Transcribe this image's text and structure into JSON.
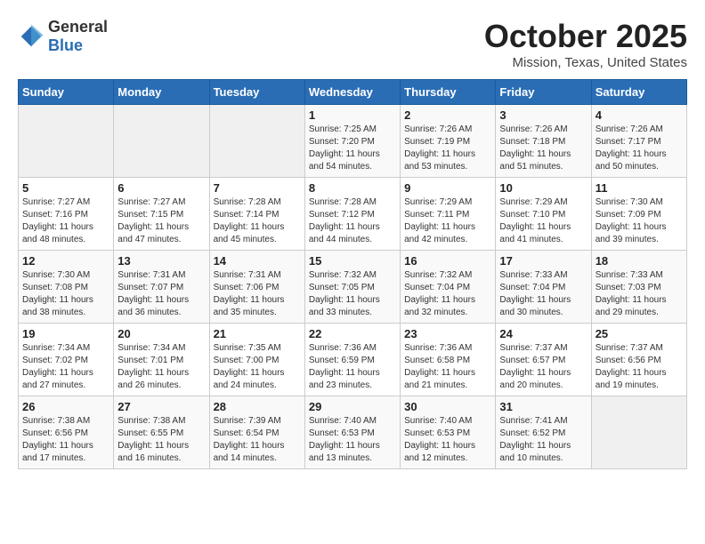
{
  "header": {
    "logo_general": "General",
    "logo_blue": "Blue",
    "month_title": "October 2025",
    "location": "Mission, Texas, United States"
  },
  "days_of_week": [
    "Sunday",
    "Monday",
    "Tuesday",
    "Wednesday",
    "Thursday",
    "Friday",
    "Saturday"
  ],
  "weeks": [
    [
      {
        "day": "",
        "sunrise": "",
        "sunset": "",
        "daylight": ""
      },
      {
        "day": "",
        "sunrise": "",
        "sunset": "",
        "daylight": ""
      },
      {
        "day": "",
        "sunrise": "",
        "sunset": "",
        "daylight": ""
      },
      {
        "day": "1",
        "sunrise": "Sunrise: 7:25 AM",
        "sunset": "Sunset: 7:20 PM",
        "daylight": "Daylight: 11 hours and 54 minutes."
      },
      {
        "day": "2",
        "sunrise": "Sunrise: 7:26 AM",
        "sunset": "Sunset: 7:19 PM",
        "daylight": "Daylight: 11 hours and 53 minutes."
      },
      {
        "day": "3",
        "sunrise": "Sunrise: 7:26 AM",
        "sunset": "Sunset: 7:18 PM",
        "daylight": "Daylight: 11 hours and 51 minutes."
      },
      {
        "day": "4",
        "sunrise": "Sunrise: 7:26 AM",
        "sunset": "Sunset: 7:17 PM",
        "daylight": "Daylight: 11 hours and 50 minutes."
      }
    ],
    [
      {
        "day": "5",
        "sunrise": "Sunrise: 7:27 AM",
        "sunset": "Sunset: 7:16 PM",
        "daylight": "Daylight: 11 hours and 48 minutes."
      },
      {
        "day": "6",
        "sunrise": "Sunrise: 7:27 AM",
        "sunset": "Sunset: 7:15 PM",
        "daylight": "Daylight: 11 hours and 47 minutes."
      },
      {
        "day": "7",
        "sunrise": "Sunrise: 7:28 AM",
        "sunset": "Sunset: 7:14 PM",
        "daylight": "Daylight: 11 hours and 45 minutes."
      },
      {
        "day": "8",
        "sunrise": "Sunrise: 7:28 AM",
        "sunset": "Sunset: 7:12 PM",
        "daylight": "Daylight: 11 hours and 44 minutes."
      },
      {
        "day": "9",
        "sunrise": "Sunrise: 7:29 AM",
        "sunset": "Sunset: 7:11 PM",
        "daylight": "Daylight: 11 hours and 42 minutes."
      },
      {
        "day": "10",
        "sunrise": "Sunrise: 7:29 AM",
        "sunset": "Sunset: 7:10 PM",
        "daylight": "Daylight: 11 hours and 41 minutes."
      },
      {
        "day": "11",
        "sunrise": "Sunrise: 7:30 AM",
        "sunset": "Sunset: 7:09 PM",
        "daylight": "Daylight: 11 hours and 39 minutes."
      }
    ],
    [
      {
        "day": "12",
        "sunrise": "Sunrise: 7:30 AM",
        "sunset": "Sunset: 7:08 PM",
        "daylight": "Daylight: 11 hours and 38 minutes."
      },
      {
        "day": "13",
        "sunrise": "Sunrise: 7:31 AM",
        "sunset": "Sunset: 7:07 PM",
        "daylight": "Daylight: 11 hours and 36 minutes."
      },
      {
        "day": "14",
        "sunrise": "Sunrise: 7:31 AM",
        "sunset": "Sunset: 7:06 PM",
        "daylight": "Daylight: 11 hours and 35 minutes."
      },
      {
        "day": "15",
        "sunrise": "Sunrise: 7:32 AM",
        "sunset": "Sunset: 7:05 PM",
        "daylight": "Daylight: 11 hours and 33 minutes."
      },
      {
        "day": "16",
        "sunrise": "Sunrise: 7:32 AM",
        "sunset": "Sunset: 7:04 PM",
        "daylight": "Daylight: 11 hours and 32 minutes."
      },
      {
        "day": "17",
        "sunrise": "Sunrise: 7:33 AM",
        "sunset": "Sunset: 7:04 PM",
        "daylight": "Daylight: 11 hours and 30 minutes."
      },
      {
        "day": "18",
        "sunrise": "Sunrise: 7:33 AM",
        "sunset": "Sunset: 7:03 PM",
        "daylight": "Daylight: 11 hours and 29 minutes."
      }
    ],
    [
      {
        "day": "19",
        "sunrise": "Sunrise: 7:34 AM",
        "sunset": "Sunset: 7:02 PM",
        "daylight": "Daylight: 11 hours and 27 minutes."
      },
      {
        "day": "20",
        "sunrise": "Sunrise: 7:34 AM",
        "sunset": "Sunset: 7:01 PM",
        "daylight": "Daylight: 11 hours and 26 minutes."
      },
      {
        "day": "21",
        "sunrise": "Sunrise: 7:35 AM",
        "sunset": "Sunset: 7:00 PM",
        "daylight": "Daylight: 11 hours and 24 minutes."
      },
      {
        "day": "22",
        "sunrise": "Sunrise: 7:36 AM",
        "sunset": "Sunset: 6:59 PM",
        "daylight": "Daylight: 11 hours and 23 minutes."
      },
      {
        "day": "23",
        "sunrise": "Sunrise: 7:36 AM",
        "sunset": "Sunset: 6:58 PM",
        "daylight": "Daylight: 11 hours and 21 minutes."
      },
      {
        "day": "24",
        "sunrise": "Sunrise: 7:37 AM",
        "sunset": "Sunset: 6:57 PM",
        "daylight": "Daylight: 11 hours and 20 minutes."
      },
      {
        "day": "25",
        "sunrise": "Sunrise: 7:37 AM",
        "sunset": "Sunset: 6:56 PM",
        "daylight": "Daylight: 11 hours and 19 minutes."
      }
    ],
    [
      {
        "day": "26",
        "sunrise": "Sunrise: 7:38 AM",
        "sunset": "Sunset: 6:56 PM",
        "daylight": "Daylight: 11 hours and 17 minutes."
      },
      {
        "day": "27",
        "sunrise": "Sunrise: 7:38 AM",
        "sunset": "Sunset: 6:55 PM",
        "daylight": "Daylight: 11 hours and 16 minutes."
      },
      {
        "day": "28",
        "sunrise": "Sunrise: 7:39 AM",
        "sunset": "Sunset: 6:54 PM",
        "daylight": "Daylight: 11 hours and 14 minutes."
      },
      {
        "day": "29",
        "sunrise": "Sunrise: 7:40 AM",
        "sunset": "Sunset: 6:53 PM",
        "daylight": "Daylight: 11 hours and 13 minutes."
      },
      {
        "day": "30",
        "sunrise": "Sunrise: 7:40 AM",
        "sunset": "Sunset: 6:53 PM",
        "daylight": "Daylight: 11 hours and 12 minutes."
      },
      {
        "day": "31",
        "sunrise": "Sunrise: 7:41 AM",
        "sunset": "Sunset: 6:52 PM",
        "daylight": "Daylight: 11 hours and 10 minutes."
      },
      {
        "day": "",
        "sunrise": "",
        "sunset": "",
        "daylight": ""
      }
    ]
  ]
}
